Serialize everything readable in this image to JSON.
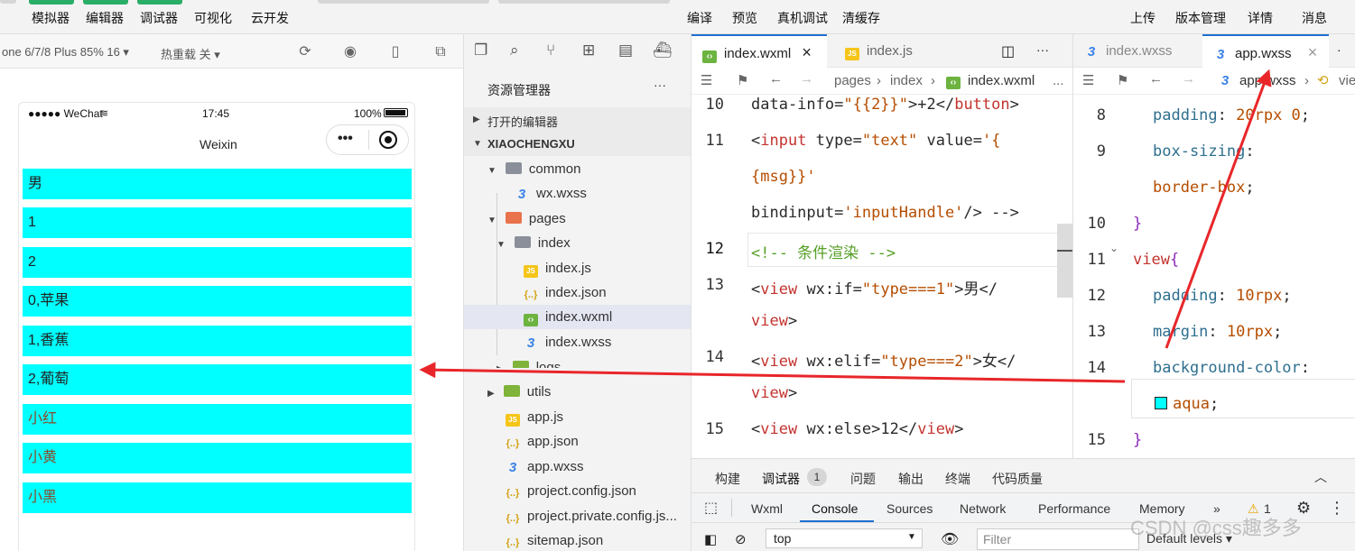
{
  "toolbar": {
    "left_items": [
      "模拟器",
      "编辑器",
      "调试器",
      "可视化",
      "云开发"
    ],
    "center_items": [
      "编译",
      "预览",
      "真机调试",
      "清缓存"
    ],
    "right_items": [
      "上传",
      "版本管理",
      "详情",
      "消息"
    ]
  },
  "simulator_bar": {
    "device": "one 6/7/8 Plus 85% 16 ▾",
    "hot_reload": "热重载 关 ▾"
  },
  "phone": {
    "carrier": "●●●●● WeChat",
    "time": "17:45",
    "battery": "100%",
    "title": "Weixin",
    "rows": [
      "男",
      "1",
      "2",
      "0,苹果",
      "1,香蕉",
      "2,葡萄",
      "小红",
      "小黄",
      "小黑"
    ],
    "row_color": "#00ffff"
  },
  "explorer": {
    "title": "资源管理器",
    "more": "···",
    "open_editors": "打开的编辑器",
    "project": "XIAOCHENGXU",
    "items": [
      {
        "label": "common",
        "icon": "folder-icon"
      },
      {
        "label": "wx.wxss",
        "icon": "wxss-file-icon"
      },
      {
        "label": "pages",
        "icon": "folder-icon"
      },
      {
        "label": "index",
        "icon": "folder-icon"
      },
      {
        "label": "index.js",
        "icon": "js-file-icon"
      },
      {
        "label": "index.json",
        "icon": "json-file-icon"
      },
      {
        "label": "index.wxml",
        "icon": "wxml-file-icon"
      },
      {
        "label": "index.wxss",
        "icon": "wxss-file-icon"
      },
      {
        "label": "logs",
        "icon": "folder-icon"
      },
      {
        "label": "utils",
        "icon": "folder-icon"
      },
      {
        "label": "app.js",
        "icon": "js-file-icon"
      },
      {
        "label": "app.json",
        "icon": "json-file-icon"
      },
      {
        "label": "app.wxss",
        "icon": "wxss-file-icon"
      },
      {
        "label": "project.config.json",
        "icon": "json-file-icon"
      },
      {
        "label": "project.private.config.js...",
        "icon": "json-file-icon"
      },
      {
        "label": "sitemap.json",
        "icon": "json-file-icon"
      }
    ]
  },
  "editor1": {
    "tabs": [
      "index.wxml",
      "index.js"
    ],
    "close": "×",
    "more": "···",
    "breadcrumb": [
      "pages",
      "index",
      "index.wxml",
      "..."
    ],
    "line_numbers": [
      "10",
      "11",
      "12",
      "13",
      "14",
      "15"
    ],
    "code": {
      "l10": [
        "data-info=",
        "\"{{2}}\"",
        ">+2</",
        "button",
        ">"
      ],
      "l11a": [
        "<",
        "input",
        " type=",
        "\"text\"",
        " value=",
        "'{"
      ],
      "l11b": "{msg}}'",
      "l11c": [
        "bindinput=",
        "'inputHandle'",
        "/> -->"
      ],
      "l12": "<!-- 条件渲染 -->",
      "l13a": [
        "<",
        "view",
        " wx:if=",
        "\"type===1\"",
        ">男</"
      ],
      "l13b": [
        "view",
        ">"
      ],
      "l14a": [
        "<",
        "view",
        " wx:elif=",
        "\"type===2\"",
        ">女</"
      ],
      "l14b": [
        "view",
        ">"
      ],
      "l15": [
        "<",
        "view",
        " wx:else",
        ">12</",
        "view",
        ">"
      ]
    }
  },
  "editor2": {
    "tabs": [
      "index.wxss",
      "app.wxss"
    ],
    "close": "×",
    "more": "·",
    "breadcrumb": [
      "app.wxss",
      "vie"
    ],
    "line_numbers": [
      "8",
      "9",
      "10",
      "11",
      "12",
      "13",
      "14",
      "15"
    ],
    "code": {
      "l8": [
        "padding",
        ": ",
        "20rpx 0",
        ";"
      ],
      "l9a": [
        "box-sizing",
        ":"
      ],
      "l9b": [
        "border-box",
        ";"
      ],
      "l10": "}",
      "l11": [
        "view",
        "{"
      ],
      "l12": [
        "padding",
        ": ",
        "10rpx",
        ";"
      ],
      "l13": [
        "margin",
        ": ",
        "10rpx",
        ";"
      ],
      "l14": [
        "background-color",
        ":"
      ],
      "l14b": [
        "aqua",
        ";"
      ],
      "l15": "}"
    }
  },
  "panel": {
    "tabs": [
      "构建",
      "调试器",
      "1",
      "问题",
      "输出",
      "终端",
      "代码质量"
    ],
    "devtools_tabs": [
      "Wxml",
      "Console",
      "Sources",
      "Network",
      "Performance",
      "Memory",
      "»"
    ],
    "warning_count": "1",
    "context": "top",
    "filter_placeholder": "Filter",
    "levels": "Default levels ▾"
  },
  "watermark": "CSDN @css趣多多",
  "colors": {
    "arrow": "#e8262a",
    "accent": "#1f6fd1"
  }
}
